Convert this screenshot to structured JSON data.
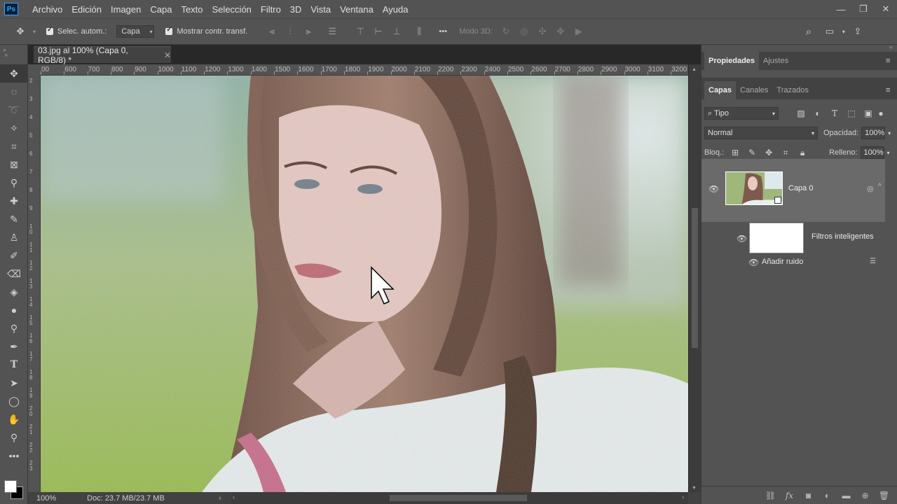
{
  "app": {
    "logo_text": "Ps"
  },
  "menu": [
    "Archivo",
    "Edición",
    "Imagen",
    "Capa",
    "Texto",
    "Selección",
    "Filtro",
    "3D",
    "Vista",
    "Ventana",
    "Ayuda"
  ],
  "window_controls": {
    "minimize": "—",
    "restore": "❐",
    "close": "✕"
  },
  "options": {
    "auto_select_label": "Selec. autom.:",
    "auto_select_value": "Capa",
    "show_transform_label": "Mostrar contr. transf.",
    "mode3d_label": "Modo 3D:",
    "more_label": "•••"
  },
  "document": {
    "tab_title": "03.jpg al 100% (Capa 0, RGB/8) *",
    "zoom": "100%",
    "doc_info": "Doc: 23.7 MB/23.7 MB",
    "ruler_top": [
      "00",
      "600",
      "700",
      "800",
      "900",
      "1000",
      "1100",
      "1200",
      "1300",
      "1400",
      "1500",
      "1600",
      "1700",
      "1800",
      "1900",
      "2000",
      "2100",
      "2200",
      "2300",
      "2400",
      "2500",
      "2600",
      "2700",
      "2800",
      "2900",
      "3000",
      "3100",
      "3200"
    ],
    "ruler_left": [
      "2",
      "3",
      "4",
      "5",
      "6",
      "7",
      "8",
      "9",
      "10",
      "11",
      "12",
      "13",
      "14",
      "15",
      "16",
      "17",
      "18",
      "19",
      "20",
      "21",
      "22",
      "23"
    ]
  },
  "panels": {
    "top_tabs": [
      "Propiedades",
      "Ajustes"
    ],
    "layer_tabs": [
      "Capas",
      "Canales",
      "Trazados"
    ],
    "filter_kind": "Tipo",
    "blend_mode": "Normal",
    "opacity_label": "Opacidad:",
    "opacity_value": "100%",
    "lock_label": "Bloq.:",
    "fill_label": "Relleno:",
    "fill_value": "100%",
    "layer_name": "Capa 0",
    "smart_filters_label": "Filtros inteligentes",
    "filter_item": "Añadir ruido"
  },
  "colors": {
    "ui_bg": "#535353",
    "canvas_bg": "#282828",
    "accent": "#31a8ff"
  }
}
